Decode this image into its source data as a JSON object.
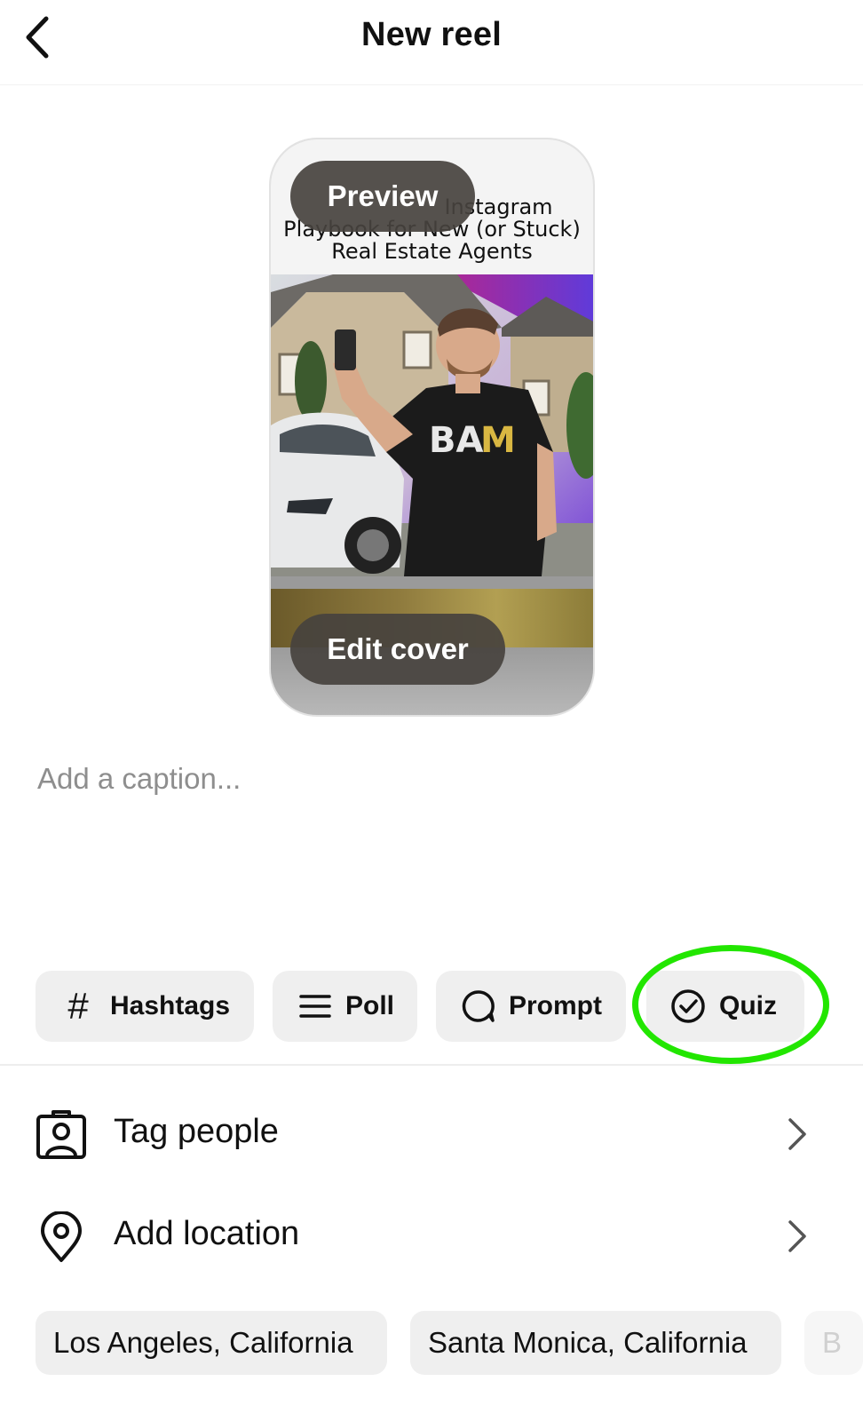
{
  "header": {
    "title": "New reel",
    "back_icon": "chevron-left-icon"
  },
  "reel": {
    "overlay_text_lines": [
      "Instagram",
      "Playbook for New (or Stuck)",
      "Real Estate Agents"
    ],
    "shirt_logo": "BAM",
    "preview_label": "Preview",
    "edit_cover_label": "Edit cover"
  },
  "caption": {
    "placeholder": "Add a caption...",
    "value": ""
  },
  "chips": {
    "hashtags": {
      "label": "Hashtags",
      "icon": "hashtag-icon"
    },
    "poll": {
      "label": "Poll",
      "icon": "list-lines-icon"
    },
    "prompt": {
      "label": "Prompt",
      "icon": "speech-bubble-icon"
    },
    "quiz": {
      "label": "Quiz",
      "icon": "check-circle-icon"
    }
  },
  "highlight_color": "#22e600",
  "rows": {
    "tag_people": {
      "label": "Tag people",
      "icon": "tag-person-icon"
    },
    "add_location": {
      "label": "Add location",
      "icon": "location-pin-icon"
    }
  },
  "location_suggestions": [
    "Los Angeles, California",
    "Santa Monica, California",
    "B"
  ]
}
